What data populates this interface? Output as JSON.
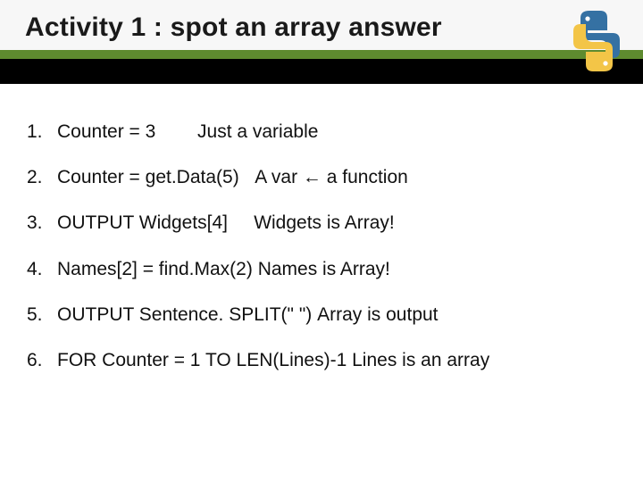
{
  "title": "Activity 1 : spot an array answer",
  "logo_label": "python",
  "items": [
    {
      "num": "1.",
      "code": "Counter = 3",
      "note": "Just a variable"
    },
    {
      "num": "2.",
      "code": "Counter = get.Data(5)",
      "note": "A var ← a function"
    },
    {
      "num": "3.",
      "code": "OUTPUT Widgets[4]",
      "note": "Widgets is Array!"
    },
    {
      "num": "4.",
      "code": "Names[2] = find.Max(2)",
      "note": "Names is Array!"
    },
    {
      "num": "5.",
      "code": "OUTPUT Sentence. SPLIT(\" \")",
      "note": "Array is output"
    },
    {
      "num": "6.",
      "code": "FOR Counter = 1 TO LEN(Lines)-1",
      "note": "Lines is an array"
    }
  ],
  "spacing": {
    "0": "        ",
    "1": "   ",
    "2": "     ",
    "3": " ",
    "4": " ",
    "5": " "
  }
}
